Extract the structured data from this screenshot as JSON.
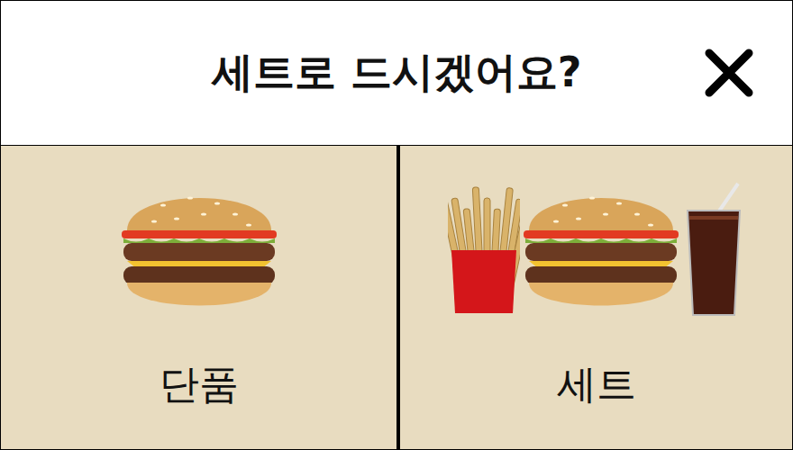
{
  "dialog": {
    "title": "세트로 드시겠어요?"
  },
  "options": [
    {
      "label": "단품",
      "kind": "single",
      "selected": false
    },
    {
      "label": "세트",
      "kind": "combo",
      "selected": false
    }
  ]
}
